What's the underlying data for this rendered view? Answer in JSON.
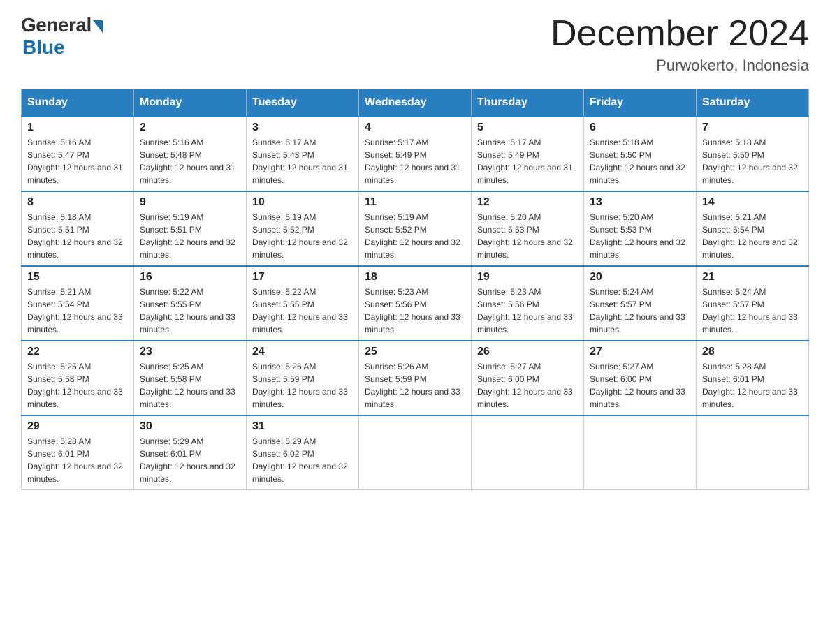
{
  "header": {
    "logo_general": "General",
    "logo_blue": "Blue",
    "month_title": "December 2024",
    "location": "Purwokerto, Indonesia"
  },
  "days_of_week": [
    "Sunday",
    "Monday",
    "Tuesday",
    "Wednesday",
    "Thursday",
    "Friday",
    "Saturday"
  ],
  "weeks": [
    [
      {
        "day": "1",
        "sunrise": "5:16 AM",
        "sunset": "5:47 PM",
        "daylight": "12 hours and 31 minutes."
      },
      {
        "day": "2",
        "sunrise": "5:16 AM",
        "sunset": "5:48 PM",
        "daylight": "12 hours and 31 minutes."
      },
      {
        "day": "3",
        "sunrise": "5:17 AM",
        "sunset": "5:48 PM",
        "daylight": "12 hours and 31 minutes."
      },
      {
        "day": "4",
        "sunrise": "5:17 AM",
        "sunset": "5:49 PM",
        "daylight": "12 hours and 31 minutes."
      },
      {
        "day": "5",
        "sunrise": "5:17 AM",
        "sunset": "5:49 PM",
        "daylight": "12 hours and 31 minutes."
      },
      {
        "day": "6",
        "sunrise": "5:18 AM",
        "sunset": "5:50 PM",
        "daylight": "12 hours and 32 minutes."
      },
      {
        "day": "7",
        "sunrise": "5:18 AM",
        "sunset": "5:50 PM",
        "daylight": "12 hours and 32 minutes."
      }
    ],
    [
      {
        "day": "8",
        "sunrise": "5:18 AM",
        "sunset": "5:51 PM",
        "daylight": "12 hours and 32 minutes."
      },
      {
        "day": "9",
        "sunrise": "5:19 AM",
        "sunset": "5:51 PM",
        "daylight": "12 hours and 32 minutes."
      },
      {
        "day": "10",
        "sunrise": "5:19 AM",
        "sunset": "5:52 PM",
        "daylight": "12 hours and 32 minutes."
      },
      {
        "day": "11",
        "sunrise": "5:19 AM",
        "sunset": "5:52 PM",
        "daylight": "12 hours and 32 minutes."
      },
      {
        "day": "12",
        "sunrise": "5:20 AM",
        "sunset": "5:53 PM",
        "daylight": "12 hours and 32 minutes."
      },
      {
        "day": "13",
        "sunrise": "5:20 AM",
        "sunset": "5:53 PM",
        "daylight": "12 hours and 32 minutes."
      },
      {
        "day": "14",
        "sunrise": "5:21 AM",
        "sunset": "5:54 PM",
        "daylight": "12 hours and 32 minutes."
      }
    ],
    [
      {
        "day": "15",
        "sunrise": "5:21 AM",
        "sunset": "5:54 PM",
        "daylight": "12 hours and 33 minutes."
      },
      {
        "day": "16",
        "sunrise": "5:22 AM",
        "sunset": "5:55 PM",
        "daylight": "12 hours and 33 minutes."
      },
      {
        "day": "17",
        "sunrise": "5:22 AM",
        "sunset": "5:55 PM",
        "daylight": "12 hours and 33 minutes."
      },
      {
        "day": "18",
        "sunrise": "5:23 AM",
        "sunset": "5:56 PM",
        "daylight": "12 hours and 33 minutes."
      },
      {
        "day": "19",
        "sunrise": "5:23 AM",
        "sunset": "5:56 PM",
        "daylight": "12 hours and 33 minutes."
      },
      {
        "day": "20",
        "sunrise": "5:24 AM",
        "sunset": "5:57 PM",
        "daylight": "12 hours and 33 minutes."
      },
      {
        "day": "21",
        "sunrise": "5:24 AM",
        "sunset": "5:57 PM",
        "daylight": "12 hours and 33 minutes."
      }
    ],
    [
      {
        "day": "22",
        "sunrise": "5:25 AM",
        "sunset": "5:58 PM",
        "daylight": "12 hours and 33 minutes."
      },
      {
        "day": "23",
        "sunrise": "5:25 AM",
        "sunset": "5:58 PM",
        "daylight": "12 hours and 33 minutes."
      },
      {
        "day": "24",
        "sunrise": "5:26 AM",
        "sunset": "5:59 PM",
        "daylight": "12 hours and 33 minutes."
      },
      {
        "day": "25",
        "sunrise": "5:26 AM",
        "sunset": "5:59 PM",
        "daylight": "12 hours and 33 minutes."
      },
      {
        "day": "26",
        "sunrise": "5:27 AM",
        "sunset": "6:00 PM",
        "daylight": "12 hours and 33 minutes."
      },
      {
        "day": "27",
        "sunrise": "5:27 AM",
        "sunset": "6:00 PM",
        "daylight": "12 hours and 33 minutes."
      },
      {
        "day": "28",
        "sunrise": "5:28 AM",
        "sunset": "6:01 PM",
        "daylight": "12 hours and 33 minutes."
      }
    ],
    [
      {
        "day": "29",
        "sunrise": "5:28 AM",
        "sunset": "6:01 PM",
        "daylight": "12 hours and 32 minutes."
      },
      {
        "day": "30",
        "sunrise": "5:29 AM",
        "sunset": "6:01 PM",
        "daylight": "12 hours and 32 minutes."
      },
      {
        "day": "31",
        "sunrise": "5:29 AM",
        "sunset": "6:02 PM",
        "daylight": "12 hours and 32 minutes."
      },
      null,
      null,
      null,
      null
    ]
  ]
}
